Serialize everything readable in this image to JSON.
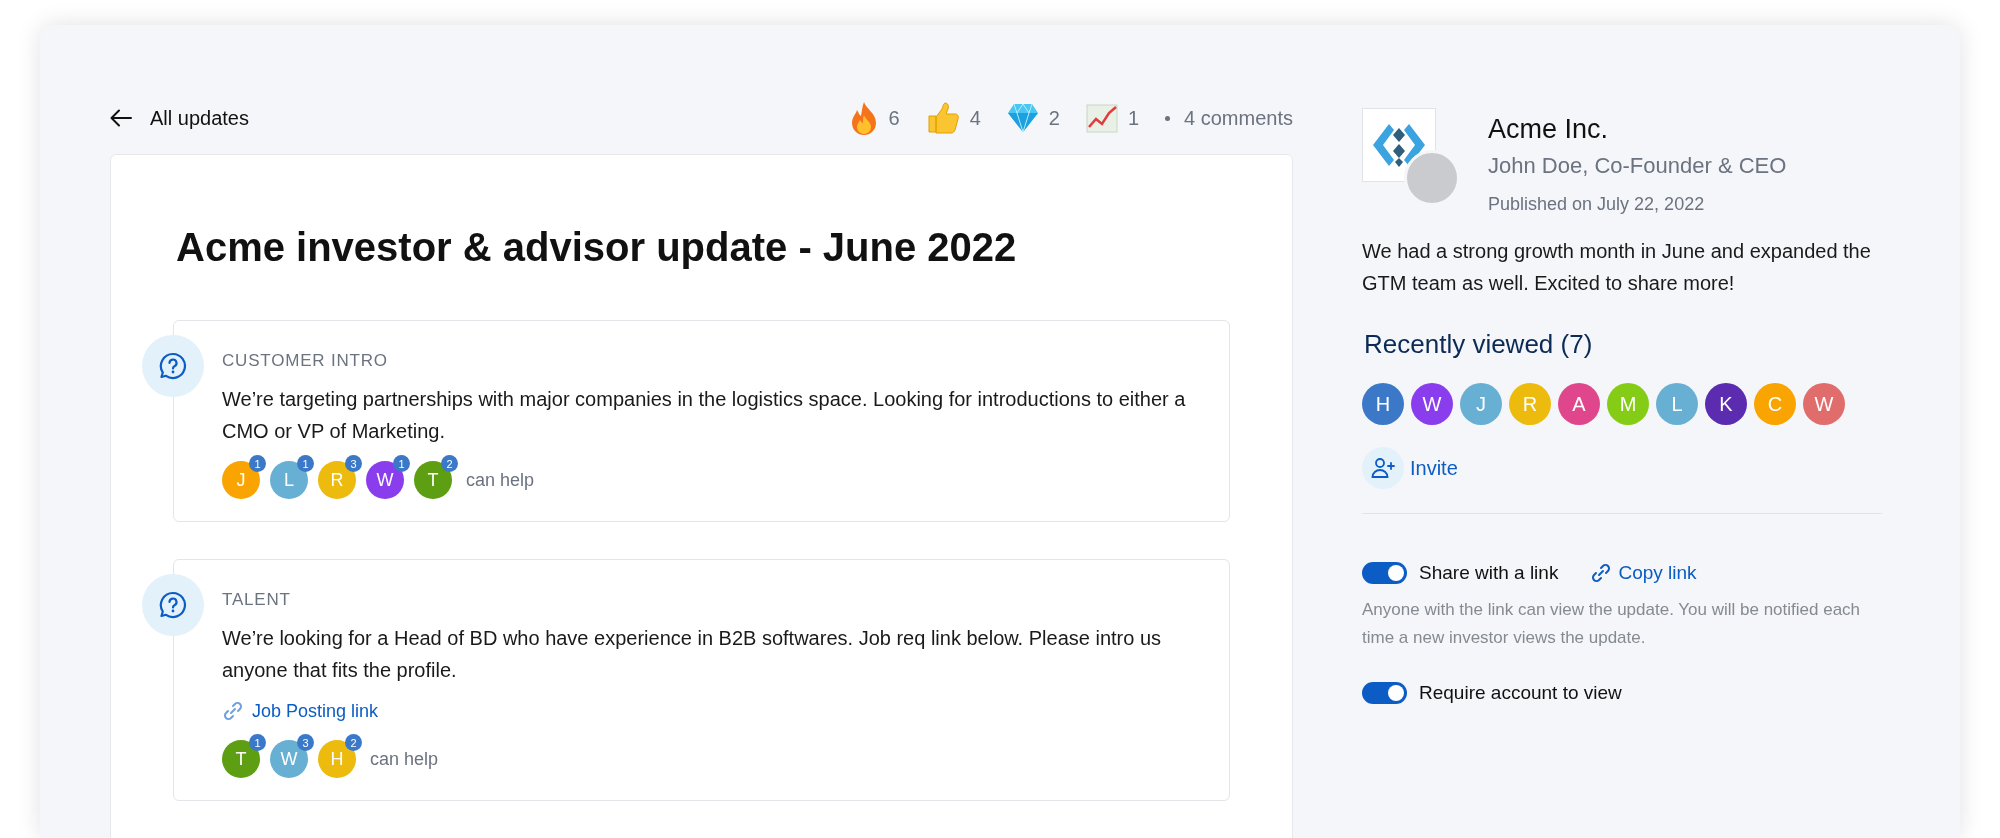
{
  "nav": {
    "back_label": "All updates"
  },
  "reactions": [
    {
      "kind": "fire",
      "count": "6"
    },
    {
      "kind": "thumbs_up",
      "count": "4"
    },
    {
      "kind": "gem",
      "count": "2"
    },
    {
      "kind": "chart",
      "count": "1"
    }
  ],
  "comments": "4 comments",
  "update": {
    "title": "Acme investor & advisor update - June 2022",
    "sections": [
      {
        "label": "CUSTOMER INTRO",
        "text": "We’re targeting partnerships with major companies in the logistics space. Looking for introductions to either a CMO or VP of Marketing.",
        "helpers": [
          {
            "initial": "J",
            "count": "1",
            "color": "#f9a400"
          },
          {
            "initial": "L",
            "count": "1",
            "color": "#67b0d3"
          },
          {
            "initial": "R",
            "count": "3",
            "color": "#ecbb0e"
          },
          {
            "initial": "W",
            "count": "1",
            "color": "#8a3ded"
          },
          {
            "initial": "T",
            "count": "2",
            "color": "#5d9e12"
          }
        ],
        "helpers_label": "can help"
      },
      {
        "label": "TALENT",
        "text": "We’re looking for a Head of BD who have experience in B2B softwares. Job req link below. Please intro us anyone that fits the profile.",
        "link": "Job Posting link",
        "helpers": [
          {
            "initial": "T",
            "count": "1",
            "color": "#5d9e12"
          },
          {
            "initial": "W",
            "count": "3",
            "color": "#67b0d3"
          },
          {
            "initial": "H",
            "count": "2",
            "color": "#ecbb0e"
          }
        ],
        "helpers_label": "can help"
      }
    ]
  },
  "sidebar": {
    "company": "Acme Inc.",
    "author": "John Doe, Co-Founder & CEO",
    "published": "Published on July 22, 2022",
    "summary": "We had a strong growth month in June and expanded the GTM team as well. Excited to share more!",
    "recently_viewed_title": "Recently viewed (7)",
    "viewers": [
      {
        "initial": "H",
        "color": "#3b79c8"
      },
      {
        "initial": "W",
        "color": "#8a3ded"
      },
      {
        "initial": "J",
        "color": "#67b0d3"
      },
      {
        "initial": "R",
        "color": "#ecbb0e"
      },
      {
        "initial": "A",
        "color": "#e0468c"
      },
      {
        "initial": "M",
        "color": "#84cc16"
      },
      {
        "initial": "L",
        "color": "#67b0d3"
      },
      {
        "initial": "K",
        "color": "#5b2bb0"
      },
      {
        "initial": "C",
        "color": "#f9a400"
      },
      {
        "initial": "W",
        "color": "#e06c6c"
      }
    ],
    "invite_label": "Invite",
    "settings": [
      {
        "label": "Share with a link",
        "on": true,
        "link": "Copy link",
        "description": "Anyone with the link can view the update. You will be notified each time a new investor views the update."
      },
      {
        "label": "Require account to view",
        "on": true
      }
    ]
  }
}
